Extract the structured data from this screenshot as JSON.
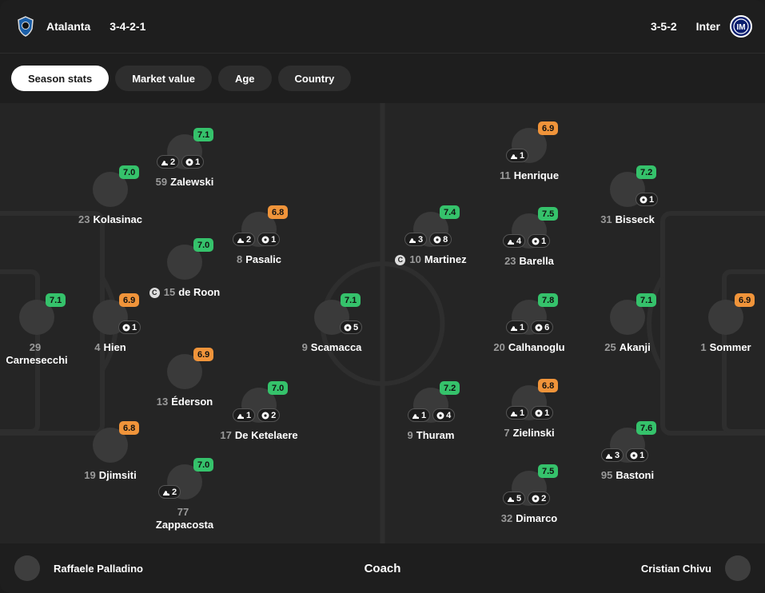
{
  "header": {
    "home": {
      "name": "Atalanta",
      "formation": "3-4-2-1",
      "crest_icon": "atalanta-crest-icon"
    },
    "away": {
      "name": "Inter",
      "formation": "3-5-2",
      "crest_icon": "inter-crest-icon"
    }
  },
  "tabs": [
    "Season stats",
    "Market value",
    "Age",
    "Country"
  ],
  "active_tab": "Season stats",
  "colors": {
    "rating_green": "#35c26b",
    "rating_orange": "#f0943a",
    "pitch": "#252525"
  },
  "home_players": [
    {
      "number": "29",
      "name": "Carnesecchi",
      "rating": "7.1",
      "goals": null,
      "assists": null
    },
    {
      "number": "4",
      "name": "Hien",
      "rating": "6.9",
      "goals": "1",
      "assists": null
    },
    {
      "number": "23",
      "name": "Kolasinac",
      "rating": "7.0",
      "goals": null,
      "assists": null
    },
    {
      "number": "19",
      "name": "Djimsiti",
      "rating": "6.8",
      "goals": null,
      "assists": null
    },
    {
      "number": "59",
      "name": "Zalewski",
      "rating": "7.1",
      "goals": "1",
      "assists": "2"
    },
    {
      "number": "15",
      "name": "de Roon",
      "rating": "7.0",
      "goals": null,
      "assists": null,
      "captain": "C"
    },
    {
      "number": "13",
      "name": "Éderson",
      "rating": "6.9",
      "goals": null,
      "assists": null
    },
    {
      "number": "77",
      "name": "Zappacosta",
      "rating": "7.0",
      "goals": null,
      "assists": "2"
    },
    {
      "number": "8",
      "name": "Pasalic",
      "rating": "6.8",
      "goals": "1",
      "assists": "2"
    },
    {
      "number": "17",
      "name": "De Ketelaere",
      "rating": "7.0",
      "goals": "2",
      "assists": "1"
    },
    {
      "number": "9",
      "name": "Scamacca",
      "rating": "7.1",
      "goals": "5",
      "assists": null
    }
  ],
  "away_players": [
    {
      "number": "10",
      "name": "Martinez",
      "rating": "7.4",
      "goals": "8",
      "assists": "3",
      "captain": "C"
    },
    {
      "number": "9",
      "name": "Thuram",
      "rating": "7.2",
      "goals": "4",
      "assists": "1"
    },
    {
      "number": "11",
      "name": "Henrique",
      "rating": "6.9",
      "goals": null,
      "assists": "1"
    },
    {
      "number": "23",
      "name": "Barella",
      "rating": "7.5",
      "goals": "1",
      "assists": "4"
    },
    {
      "number": "20",
      "name": "Calhanoglu",
      "rating": "7.8",
      "goals": "6",
      "assists": "1"
    },
    {
      "number": "7",
      "name": "Zielinski",
      "rating": "6.8",
      "goals": "1",
      "assists": "1"
    },
    {
      "number": "32",
      "name": "Dimarco",
      "rating": "7.5",
      "goals": "2",
      "assists": "5"
    },
    {
      "number": "31",
      "name": "Bisseck",
      "rating": "7.2",
      "goals": "1",
      "assists": null
    },
    {
      "number": "25",
      "name": "Akanji",
      "rating": "7.1",
      "goals": null,
      "assists": null
    },
    {
      "number": "95",
      "name": "Bastoni",
      "rating": "7.6",
      "goals": "1",
      "assists": "3"
    },
    {
      "number": "1",
      "name": "Sommer",
      "rating": "6.9",
      "goals": null,
      "assists": null
    }
  ],
  "coaches": {
    "label": "Coach",
    "home": "Raffaele Palladino",
    "away": "Cristian Chivu"
  }
}
